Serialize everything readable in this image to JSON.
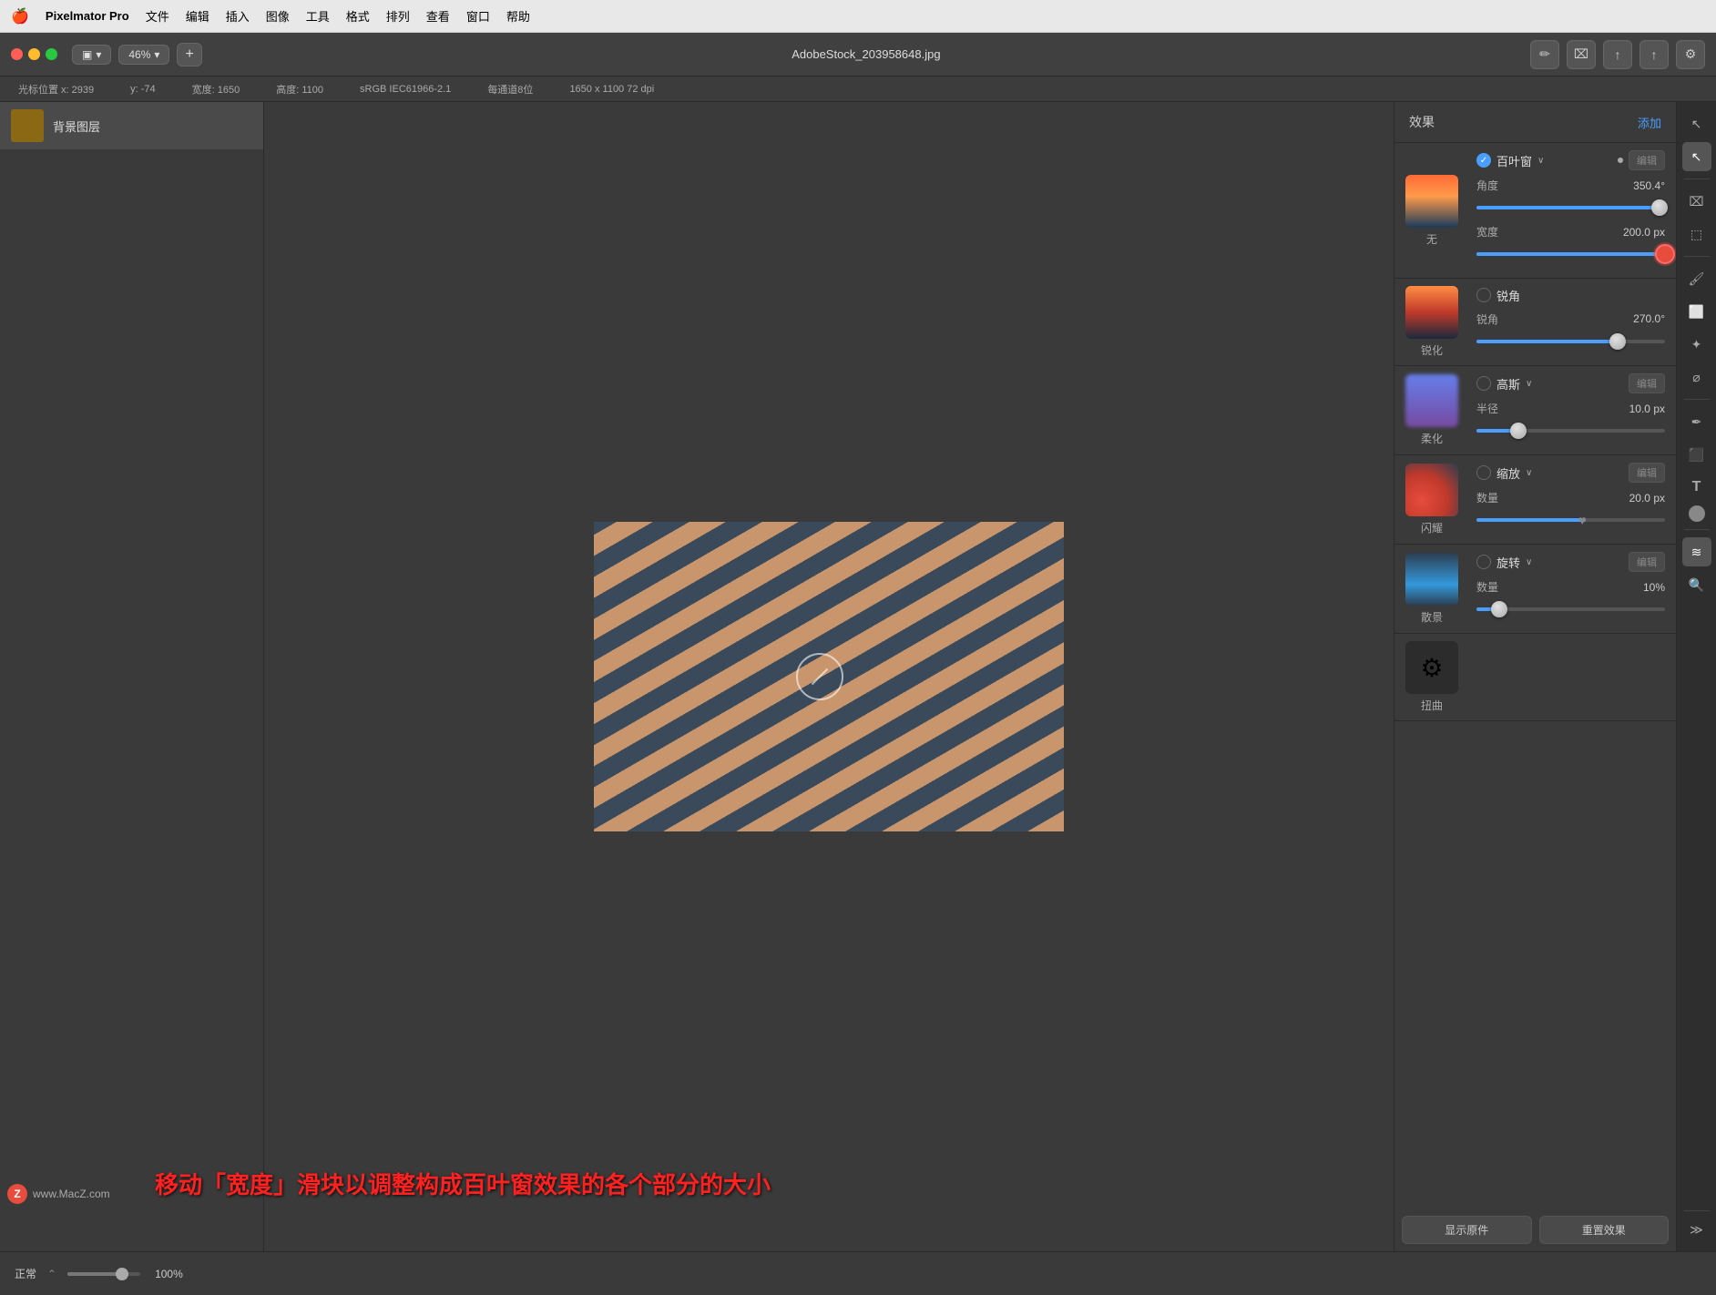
{
  "menubar": {
    "apple": "🍎",
    "app": "Pixelmator Pro",
    "items": [
      "文件",
      "编辑",
      "插入",
      "图像",
      "工具",
      "格式",
      "排列",
      "查看",
      "窗口",
      "帮助"
    ]
  },
  "toolbar": {
    "zoom": "46%",
    "plus": "+",
    "title": "AdobeStock_203958648.jpg",
    "icons": [
      "✏️",
      "⬜",
      "⬆️",
      "⬆️",
      "⚙️"
    ]
  },
  "statusbar": {
    "cursor_pos": "光标位置 x: 2939",
    "y": "y: -74",
    "width": "宽度: 1650",
    "height": "高度: 1100",
    "colorspace": "sRGB IEC61966-2.1",
    "depth": "每通道8位",
    "dimensions": "1650 x 1100 72 dpi"
  },
  "layers": {
    "background_layer": "背景图层"
  },
  "effects": {
    "title": "效果",
    "add_label": "添加",
    "sections": [
      {
        "id": "blinds",
        "thumb_type": "sunset",
        "label": "无",
        "effect_name": "百叶窗",
        "enabled": true,
        "edit_label": "编辑",
        "controls": [
          {
            "label": "角度",
            "value": "350.4°",
            "slider_pct": 0.97,
            "thumb_type": "gray"
          },
          {
            "label": "宽度",
            "value": "200.0 px",
            "slider_pct": 1.0,
            "thumb_type": "red"
          }
        ]
      },
      {
        "id": "sharpen",
        "thumb_type": "tree-dark",
        "label": "锐化",
        "effect_name": "锐角",
        "enabled": false,
        "controls": [
          {
            "label": "锐角",
            "value": "270.0°",
            "slider_pct": 0.75,
            "thumb_type": "gray"
          }
        ]
      },
      {
        "id": "blur",
        "thumb_type": "blur",
        "label": "柔化",
        "effect_name": "高斯",
        "enabled": false,
        "edit_label": "编辑",
        "controls": [
          {
            "label": "半径",
            "value": "10.0 px",
            "slider_pct": 0.22,
            "thumb_type": "blue"
          }
        ]
      },
      {
        "id": "flare",
        "thumb_type": "bokeh",
        "label": "闪耀",
        "effect_name": "缩放",
        "enabled": false,
        "edit_label": "编辑",
        "controls": [
          {
            "label": "数量",
            "value": "20.0 px",
            "slider_pct": 0.58,
            "thumb_type": "heart"
          }
        ]
      },
      {
        "id": "bokeh",
        "thumb_type": "landscape",
        "label": "散景",
        "effect_name": "旋转",
        "enabled": false,
        "edit_label": "编辑",
        "controls": [
          {
            "label": "数量",
            "value": "10%",
            "slider_pct": 0.12,
            "thumb_type": "blue"
          }
        ]
      },
      {
        "id": "distort",
        "thumb_type": "gear",
        "label": "扭曲",
        "effect_name": "",
        "enabled": false,
        "controls": []
      }
    ]
  },
  "bottom_bar": {
    "mode": "正常",
    "show_original": "显示原件",
    "reset_effects": "重置效果"
  },
  "annotation": {
    "text": "移动「宽度」滑块以调整构成百叶窗效果的各个部分的大小"
  },
  "watermark": {
    "symbol": "Z",
    "url": "www.MacZ.com"
  }
}
